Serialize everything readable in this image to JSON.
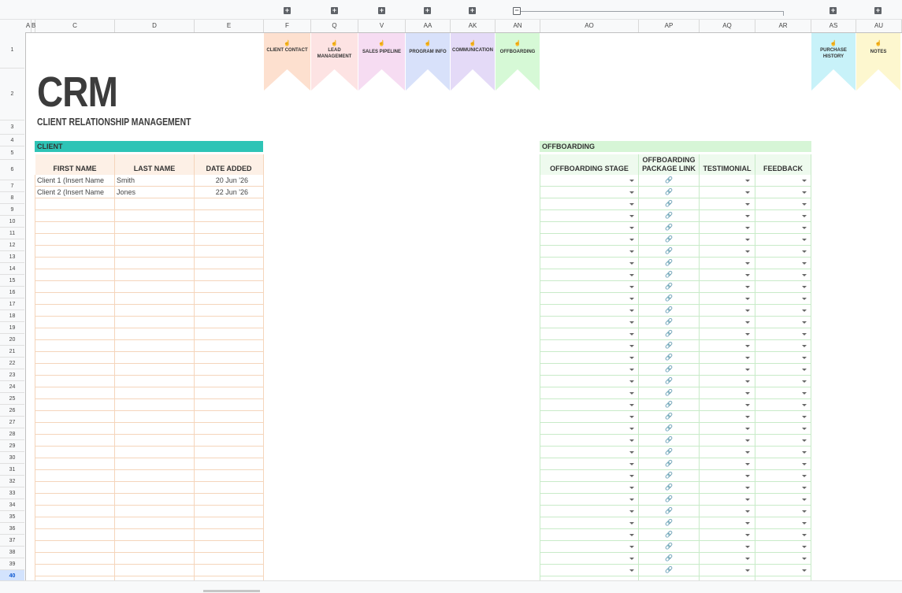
{
  "columns": {
    "headers": [
      "A",
      "B",
      "C",
      "D",
      "E",
      "F",
      "Q",
      "V",
      "AA",
      "AK",
      "AN",
      "AO",
      "AP",
      "AQ",
      "AR",
      "AS",
      "AU"
    ]
  },
  "rows": [
    "1",
    "2",
    "3",
    "4",
    "5",
    "6",
    "7",
    "8",
    "9",
    "10",
    "11",
    "12",
    "13",
    "14",
    "15",
    "16",
    "17",
    "18",
    "19",
    "20",
    "21",
    "22",
    "23",
    "24",
    "25",
    "26",
    "27",
    "28",
    "29",
    "30",
    "31",
    "32",
    "33",
    "34",
    "35",
    "36",
    "37",
    "38",
    "39",
    "40"
  ],
  "selected_row": "40",
  "banners": [
    {
      "label": "CLIENT CONTACT",
      "color": "#fde0cf",
      "icon": "hand-pointer-icon"
    },
    {
      "label": "LEAD MANAGEMENT",
      "color": "#fde3e3",
      "icon": "hand-pointer-icon"
    },
    {
      "label": "SALES PIPELINE",
      "color": "#f6dcf2",
      "icon": "hand-pointer-icon"
    },
    {
      "label": "PROGRAM INFO",
      "color": "#d8e1fa",
      "icon": "hand-pointer-icon"
    },
    {
      "label": "COMMUNICATION",
      "color": "#e4daf7",
      "icon": "hand-pointer-icon"
    },
    {
      "label": "OFFBOARDING",
      "color": "#d6f9d6",
      "icon": "hand-pointer-icon"
    },
    {
      "label": "PURCHASE HISTORY",
      "color": "#c8f2f9",
      "icon": "hand-pointer-icon"
    },
    {
      "label": "NOTES",
      "color": "#fdf7cf",
      "icon": "hand-pointer-icon"
    }
  ],
  "title": "CRM",
  "subtitle": "CLIENT RELATIONSHIP MANAGEMENT",
  "client": {
    "section_label": "CLIENT",
    "headers": [
      "FIRST NAME",
      "LAST NAME",
      "DATE ADDED"
    ],
    "rows": [
      [
        "Client 1 (Insert Name",
        "Smith",
        "20 Jun '26"
      ],
      [
        "Client 2 (Insert Name",
        "Jones",
        "22 Jun '26"
      ]
    ]
  },
  "offboarding": {
    "section_label": "OFFBOARDING",
    "headers": [
      "OFFBOARDING STAGE",
      "OFFBOARDING PACKAGE LINK",
      "TESTIMONIAL",
      "FEEDBACK"
    ]
  },
  "icons": {
    "group_expand": "plus-box-icon",
    "group_collapse": "minus-box-icon",
    "link": "link-icon",
    "dropdown": "dropdown-arrow-icon"
  },
  "colors": {
    "client_accent": "#2ec4b6",
    "offboarding_accent": "#d6f5d6"
  }
}
